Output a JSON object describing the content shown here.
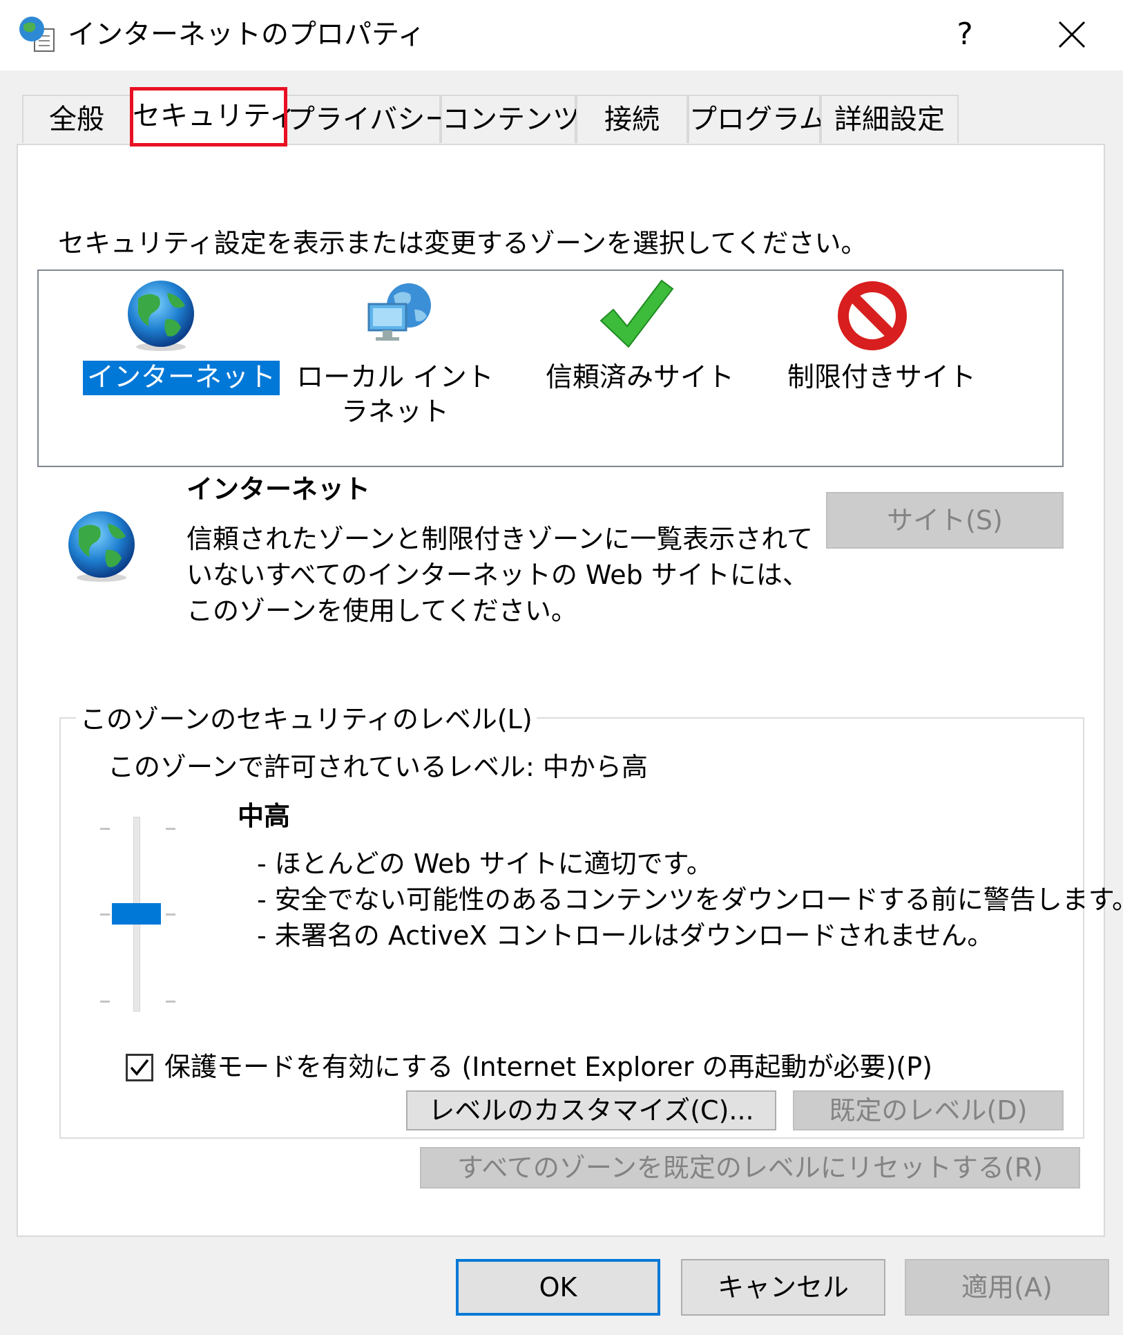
{
  "window": {
    "title": "インターネットのプロパティ",
    "help_label": "?",
    "close_label": "×"
  },
  "tabs": [
    {
      "label": "全般"
    },
    {
      "label": "セキュリティ"
    },
    {
      "label": "プライバシー"
    },
    {
      "label": "コンテンツ"
    },
    {
      "label": "接続"
    },
    {
      "label": "プログラム"
    },
    {
      "label": "詳細設定"
    }
  ],
  "security": {
    "instruction": "セキュリティ設定を表示または変更するゾーンを選択してください。",
    "zones": [
      {
        "label": "インターネット",
        "icon": "globe-icon",
        "selected": true
      },
      {
        "label": "ローカル イントラネット",
        "icon": "intranet-icon",
        "selected": false
      },
      {
        "label": "信頼済みサイト",
        "icon": "checkmark-icon",
        "selected": false
      },
      {
        "label": "制限付きサイト",
        "icon": "restricted-icon",
        "selected": false
      }
    ],
    "selected_zone": {
      "title": "インターネット",
      "description": "信頼されたゾーンと制限付きゾーンに一覧表示されていないすべてのインターネットの Web サイトには、このゾーンを使用してください。"
    },
    "sites_button": "サイト(S)",
    "level_group": {
      "legend": "このゾーンのセキュリティのレベル(L)",
      "allowed_levels": "このゾーンで許可されているレベル: 中から高",
      "level_name": "中高",
      "slider_level_fraction": 0.5,
      "bullets": [
        "- ほとんどの Web サイトに適切です。",
        "- 安全でない可能性のあるコンテンツをダウンロードする前に警告します。",
        "- 未署名の ActiveX コントロールはダウンロードされません。"
      ],
      "protected_mode_label": "保護モードを有効にする (Internet Explorer の再起動が必要)(P)",
      "protected_mode_checked": true,
      "custom_level_button": "レベルのカスタマイズ(C)...",
      "default_level_button": "既定のレベル(D)"
    },
    "reset_all_button": "すべてのゾーンを既定のレベルにリセットする(R)"
  },
  "footer": {
    "ok": "OK",
    "cancel": "キャンセル",
    "apply": "適用(A)"
  },
  "colors": {
    "accent": "#0078d7",
    "highlight_box": "#e81123"
  }
}
